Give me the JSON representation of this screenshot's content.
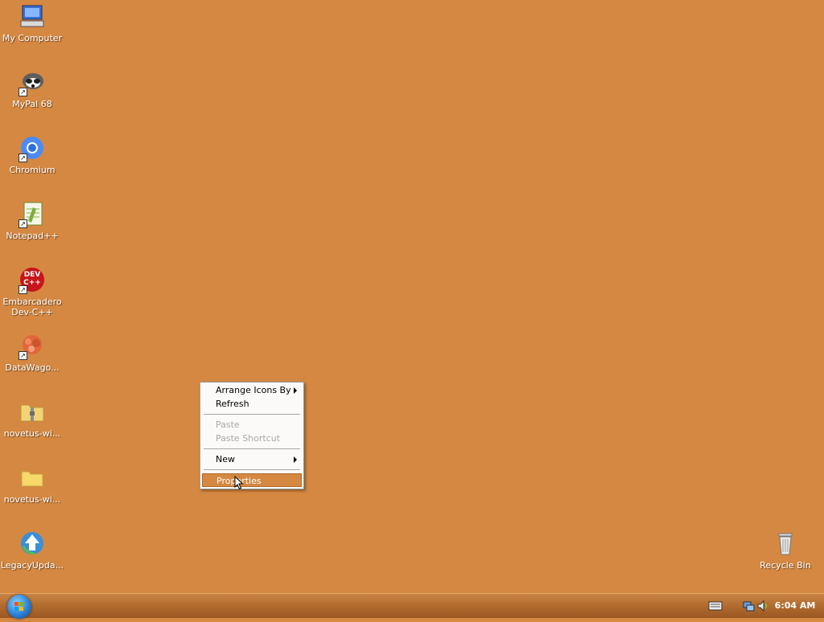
{
  "desktop_icons": [
    {
      "label": "My Computer",
      "icon": "my-computer-icon"
    },
    {
      "label": "MyPal 68",
      "icon": "mypal-icon"
    },
    {
      "label": "Chromium",
      "icon": "chromium-icon"
    },
    {
      "label": "Notepad++",
      "icon": "notepad-plus-plus-icon"
    },
    {
      "label": "Embarcadero Dev-C++",
      "icon": "dev-cpp-icon",
      "badge": "DEV C++"
    },
    {
      "label": "DataWago...",
      "icon": "datawagon-icon"
    },
    {
      "label": "novetus-wi...",
      "icon": "zip-folder-icon"
    },
    {
      "label": "novetus-wi...",
      "icon": "folder-icon"
    },
    {
      "label": "LegacyUpda...",
      "icon": "legacy-update-icon"
    },
    {
      "label": "Recycle Bin",
      "icon": "recycle-bin-icon"
    }
  ],
  "context_menu": {
    "items": [
      {
        "label": "Arrange Icons By",
        "submenu": true
      },
      {
        "label": "Refresh"
      },
      {
        "label": "Paste",
        "disabled": true
      },
      {
        "label": "Paste Shortcut",
        "disabled": true
      },
      {
        "label": "New",
        "submenu": true
      },
      {
        "label": "Properties",
        "selected": true
      }
    ]
  },
  "taskbar": {
    "clock": "6:04 AM",
    "tray_icons": [
      "keyboard-icon",
      "network-icon",
      "volume-icon"
    ]
  },
  "colors": {
    "desktop": "#D58841",
    "menu_highlight": "#D58841"
  }
}
